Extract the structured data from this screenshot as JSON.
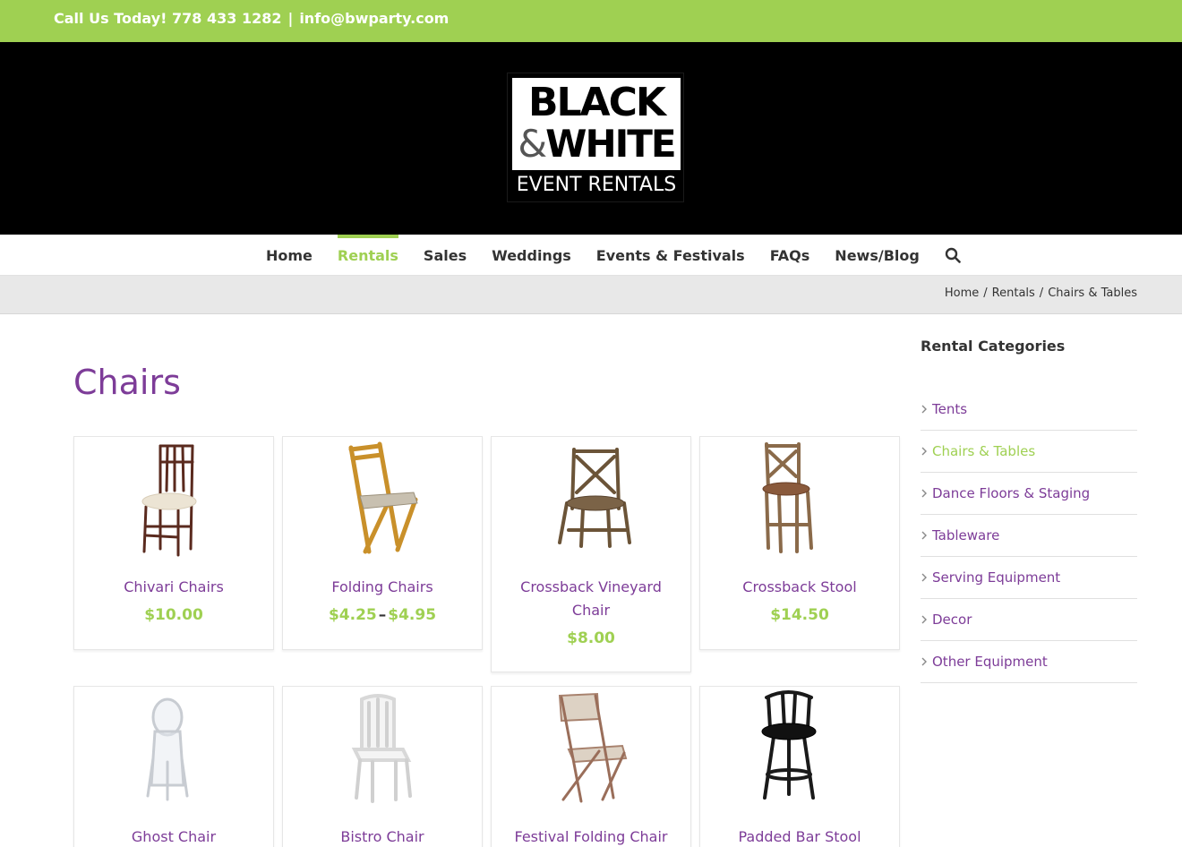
{
  "topbar": {
    "phone_text": "Call Us Today! 778 433 1282",
    "separator": "|",
    "email": "info@bwparty.com"
  },
  "logo": {
    "line1": "BLACK",
    "line2_amp": "&",
    "line2_word": "WHITE",
    "line3": "EVENT RENTALS"
  },
  "nav": {
    "items": [
      {
        "label": "Home",
        "active": false
      },
      {
        "label": "Rentals",
        "active": true
      },
      {
        "label": "Sales",
        "active": false
      },
      {
        "label": "Weddings",
        "active": false
      },
      {
        "label": "Events & Festivals",
        "active": false
      },
      {
        "label": "FAQs",
        "active": false
      },
      {
        "label": "News/Blog",
        "active": false
      }
    ],
    "search_icon": "search-icon"
  },
  "breadcrumb": {
    "items": [
      "Home",
      "Rentals",
      "Chairs & Tables"
    ],
    "separator": "/"
  },
  "page": {
    "title": "Chairs"
  },
  "products": [
    {
      "name": "Chivari Chairs",
      "price": "$10.00"
    },
    {
      "name": "Folding Chairs",
      "price_low": "$4.25",
      "price_sep": "–",
      "price_high": "$4.95"
    },
    {
      "name": "Crossback Vineyard Chair",
      "price": "$8.00"
    },
    {
      "name": "Crossback Stool",
      "price": "$14.50"
    },
    {
      "name": "Ghost Chair"
    },
    {
      "name": "Bistro Chair"
    },
    {
      "name": "Festival Folding Chair"
    },
    {
      "name": "Padded Bar Stool"
    }
  ],
  "sidebar": {
    "title": "Rental Categories",
    "categories": [
      {
        "label": "Tents",
        "active": false
      },
      {
        "label": "Chairs & Tables",
        "active": true
      },
      {
        "label": "Dance Floors & Staging",
        "active": false
      },
      {
        "label": "Tableware",
        "active": false
      },
      {
        "label": "Serving Equipment",
        "active": false
      },
      {
        "label": "Decor",
        "active": false
      },
      {
        "label": "Other Equipment",
        "active": false
      }
    ]
  },
  "colors": {
    "accent_green": "#9fd052",
    "link_purple": "#7d3c98",
    "header_black": "#000000"
  }
}
